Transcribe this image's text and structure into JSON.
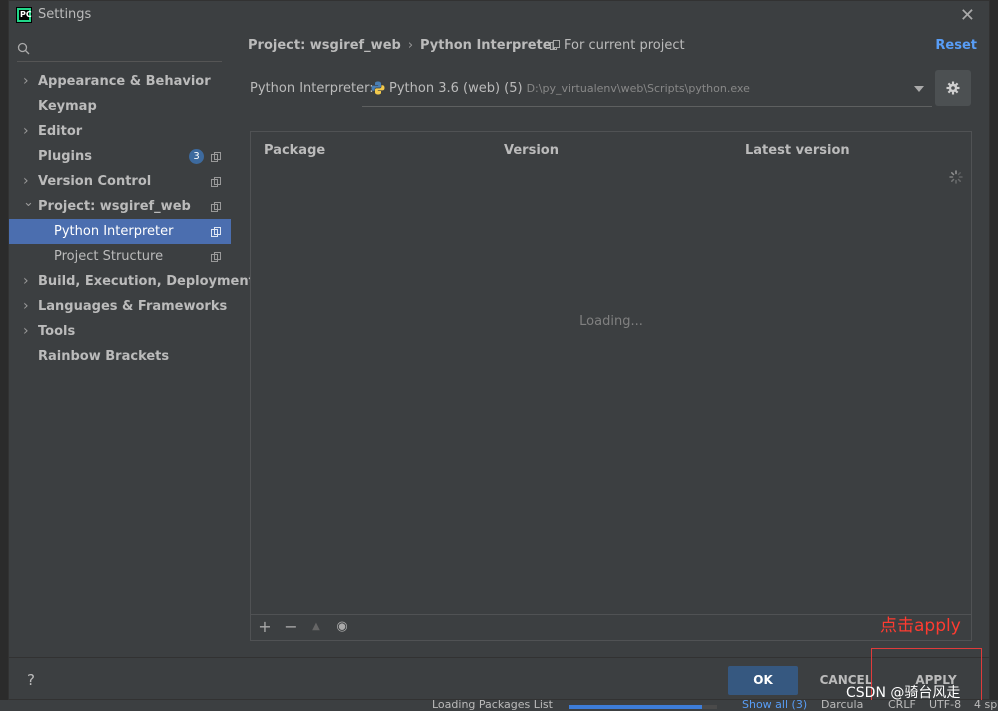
{
  "window": {
    "title": "Settings",
    "app_icon_text": "PC"
  },
  "sidebar": {
    "search_placeholder": "",
    "items": [
      {
        "label": "Appearance & Behavior",
        "expandable": true
      },
      {
        "label": "Keymap",
        "expandable": false
      },
      {
        "label": "Editor",
        "expandable": true
      },
      {
        "label": "Plugins",
        "expandable": false,
        "badge": "3"
      },
      {
        "label": "Version Control",
        "expandable": true
      },
      {
        "label": "Project: wsgiref_web",
        "expandable": true,
        "expanded": true
      },
      {
        "label": "Python Interpreter",
        "child": true,
        "selected": true
      },
      {
        "label": "Project Structure",
        "child": true
      },
      {
        "label": "Build, Execution, Deployment",
        "expandable": true
      },
      {
        "label": "Languages & Frameworks",
        "expandable": true
      },
      {
        "label": "Tools",
        "expandable": true
      },
      {
        "label": "Rainbow Brackets",
        "expandable": false
      }
    ]
  },
  "header": {
    "breadcrumb_project": "Project: wsgiref_web",
    "breadcrumb_separator": "›",
    "breadcrumb_page": "Python Interpreter",
    "for_current_project": "For current project",
    "reset": "Reset"
  },
  "interpreter": {
    "label": "Python Interpreter:",
    "name": "Python 3.6 (web) (5)",
    "path": "D:\\py_virtualenv\\web\\Scripts\\python.exe"
  },
  "packages": {
    "columns": [
      "Package",
      "Version",
      "Latest version"
    ],
    "loading_text": "Loading..."
  },
  "toolbar": {
    "add": "+",
    "remove": "−",
    "upgrade": "▲",
    "show": "◉"
  },
  "annotation": {
    "text": "点击apply"
  },
  "footer": {
    "help": "?",
    "ok": "OK",
    "cancel": "CANCEL",
    "apply": "APPLY"
  },
  "status_bar": {
    "task": "Loading Packages List",
    "progress": 0.9,
    "show_all": "Show all (3)",
    "theme": "Darcula",
    "line_sep": "CRLF",
    "encoding": "UTF-8",
    "indent": "4 sp"
  },
  "watermark": "CSDN @骑台风走",
  "colors": {
    "dialog_bg": "#3c3f41",
    "selection": "#4b6eaf",
    "link": "#589df6",
    "ok_button": "#365880",
    "annotation": "#ff3b30"
  }
}
